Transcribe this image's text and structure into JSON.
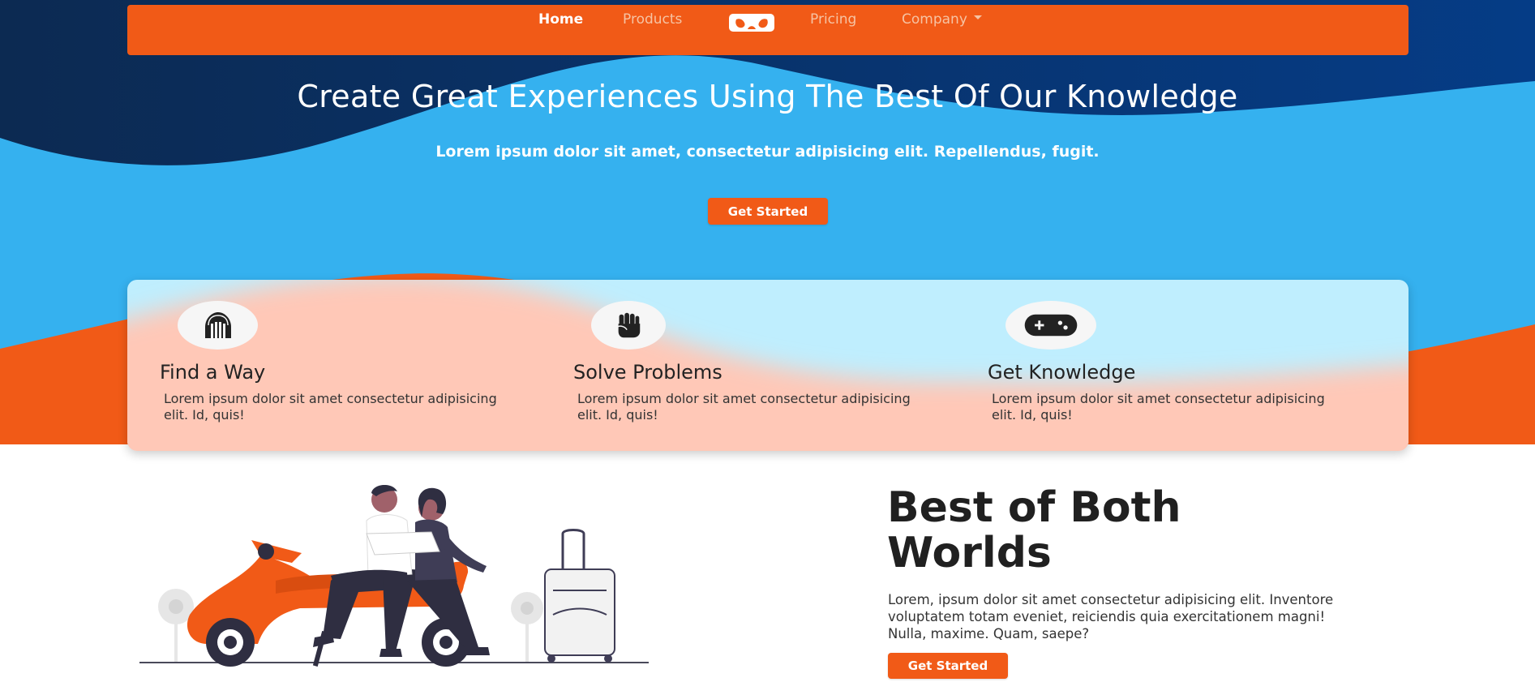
{
  "nav": {
    "links": [
      "Home",
      "Products",
      "Pricing",
      "Company"
    ],
    "active": "Home",
    "brand_icon": "vr-headset-icon"
  },
  "hero": {
    "title": "Create Great Experiences Using The Best Of Our Knowledge",
    "subtitle": "Lorem ipsum dolor sit amet, consectetur adipisicing elit. Repellendus, fugit.",
    "cta_label": "Get Started"
  },
  "features": [
    {
      "icon": "dungeon-icon",
      "title": "Find a Way",
      "text": "Lorem ipsum dolor sit amet consectetur adipisicing elit. Id, quis!"
    },
    {
      "icon": "fist-icon",
      "title": "Solve Problems",
      "text": "Lorem ipsum dolor sit amet consectetur adipisicing elit. Id, quis!"
    },
    {
      "icon": "gamepad-icon",
      "title": "Get Knowledge",
      "text": "Lorem ipsum dolor sit amet consectetur adipisicing elit. Id, quis!"
    }
  ],
  "section": {
    "title": "Best of Both Worlds",
    "text": "Lorem, ipsum dolor sit amet consectetur adipisicing elit. Inventore voluptatem totam eveniet, reiciendis quia exercitationem magni! Nulla, maxime. Quam, saepe?",
    "cta_label": "Get Started",
    "illustration": "scooter-couple-illustration"
  },
  "colors": {
    "accent": "#f15a17",
    "hero_blue": "#35b1ef",
    "hero_dark": "#0a2f5e",
    "text_dark": "#202020"
  }
}
